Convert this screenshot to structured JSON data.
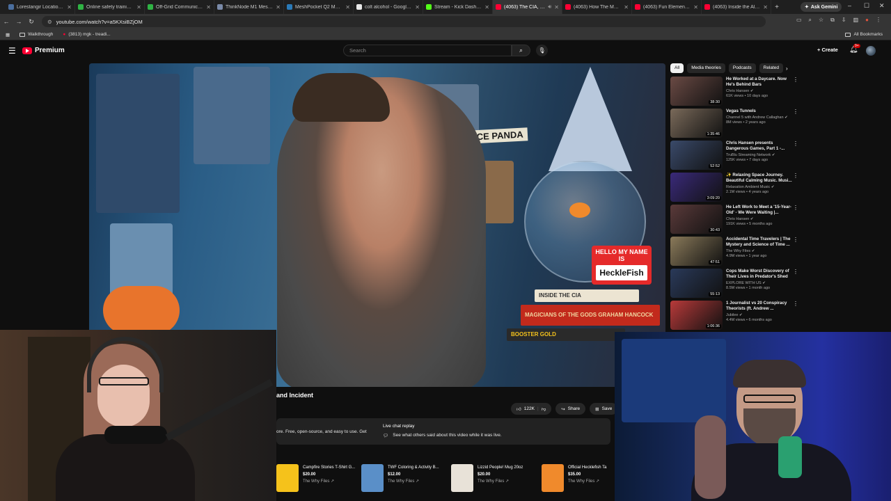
{
  "browser": {
    "tabs": [
      {
        "title": "Lorestangir Locations -",
        "color": "#4a6e9e",
        "active": false
      },
      {
        "title": "Online safety training |",
        "color": "#2fb344",
        "active": false
      },
      {
        "title": "Off-Grid Communicatio",
        "color": "#2fb344",
        "active": false
      },
      {
        "title": "ThinkNode M1 Meshtas",
        "color": "#7a8aa8",
        "active": false
      },
      {
        "title": "MeshPocket Q2 Magne",
        "color": "#2a7ab8",
        "active": false
      },
      {
        "title": "colt alcohol - Google Se",
        "color": "#e8e8e8",
        "active": false
      },
      {
        "title": "Stream - Kick Dashboa",
        "color": "#53fc18",
        "active": false
      },
      {
        "title": "(4063) The CIA, Mer",
        "color": "#ff0033",
        "active": true
      },
      {
        "title": "(4063) How The Most H",
        "color": "#ff0033",
        "active": false
      },
      {
        "title": "(4063) Fun Elementary H",
        "color": "#ff0033",
        "active": false
      },
      {
        "title": "(4063) Inside the All-W",
        "color": "#ff0033",
        "active": false
      }
    ],
    "new_tab": "+",
    "gemini_label": "Ask Gemini",
    "url": "youtube.com/watch?v=a5KXsiBZjOM",
    "bookmarks": [
      {
        "label": "Walkthrough",
        "type": "folder"
      },
      {
        "label": "(3813) mgk - treadi...",
        "type": "youtube"
      }
    ],
    "all_bookmarks": "All Bookmarks"
  },
  "youtube": {
    "logo_text": "Premium",
    "search_placeholder": "Search",
    "create_label": "Create",
    "notif_badge": "9+"
  },
  "video": {
    "thumbnail_sign": "SPACE PANDA",
    "namecard_hello": "HELLO MY NAME IS",
    "namecard_name": "HeckleFish",
    "books": [
      "INSIDE THE CIA",
      "MAGICIANS OF THE GODS  GRAHAM HANCOCK",
      "BOOSTER GOLD"
    ],
    "title_fragment": "and Incident",
    "likes": "122K",
    "share_label": "Share",
    "save_label": "Save",
    "desc_fragment": "ore. Free, open-source, and easy to use. Get",
    "live_chat_title": "Live chat replay",
    "live_chat_sub": "See what others said about this video while it was live."
  },
  "merch": [
    {
      "name": "Campfire Stories T-Shirt G...",
      "price": "$20.00",
      "seller": "The Why Files",
      "color": "#f5c21b"
    },
    {
      "name": "TWF Coloring & Activity B...",
      "price": "$12.00",
      "seller": "The Why Files",
      "color": "#5a8fc8"
    },
    {
      "name": "Lizzid People! Mug 20oz",
      "price": "$20.00",
      "seller": "The Why Files",
      "color": "#e8e2d8"
    },
    {
      "name": "Official Hecklefish Ta",
      "price": "$35.00",
      "seller": "The Why Files",
      "color": "#f08a2c"
    }
  ],
  "sidebar": {
    "chips": [
      "All",
      "Media theories",
      "Podcasts",
      "Related"
    ],
    "videos": [
      {
        "title": "He Worked at a Daycare. Now He's Behind Bars",
        "channel": "Chris Hansen",
        "stats": "61K views • 10 days ago",
        "duration": "38:30",
        "color": "#6a4a44"
      },
      {
        "title": "Vegas Tunnels",
        "channel": "Channel 5 with Andrew Callaghan",
        "stats": "8M views • 2 years ago",
        "duration": "1:35:46",
        "color": "#7a6a5a"
      },
      {
        "title": "Chris Hansen presents Dangerous Games, Part 1 -...",
        "channel": "TruBlu Streaming Network",
        "stats": "125K views • 7 days ago",
        "duration": "52:52",
        "color": "#3a4a6a"
      },
      {
        "title": "✨ Relaxing Space Journey. Beautiful Calming Music. Musi...",
        "channel": "Relaxation Ambient Music",
        "stats": "2.1M views • 4 years ago",
        "duration": "3:09:20",
        "color": "#3a2a7a"
      },
      {
        "title": "He Left Work to Meet a '15-Year-Old' - We Were Waiting |...",
        "channel": "Chris Hansen",
        "stats": "191K views • 5 months ago",
        "duration": "30:43",
        "color": "#5a3a3a"
      },
      {
        "title": "Accidental Time Travelers | The Mystery and Science of Time ...",
        "channel": "The Why Files",
        "stats": "4.9M views • 1 year ago",
        "duration": "47:51",
        "color": "#8a7a5a"
      },
      {
        "title": "Cops Make Worst Discovery of Their Lives in Predator's Shed",
        "channel": "EXPLORE WITH US",
        "stats": "8.5M views • 1 month ago",
        "duration": "55:13",
        "color": "#2a3a5a"
      },
      {
        "title": "1 Journalist vs 20 Conspiracy Theorists (ft. Andrew ...",
        "channel": "Jubilee",
        "stats": "4.4M views • 6 months ago",
        "duration": "1:06:36",
        "color": "#b83a3a"
      }
    ]
  }
}
